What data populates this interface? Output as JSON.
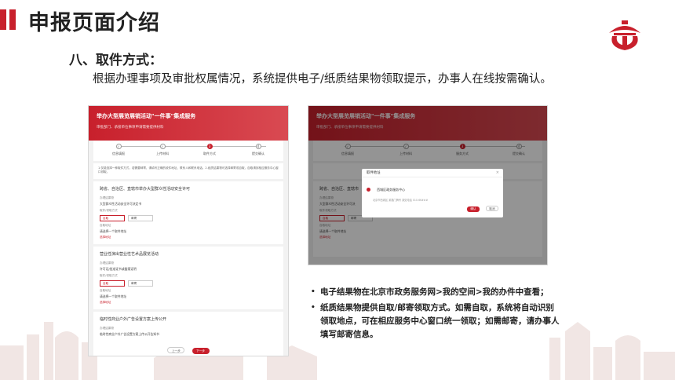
{
  "slide": {
    "title": "申报页面介绍",
    "section_title": "八、取件方式：",
    "section_desc": "根据办理事项及审批权属情况，系统提供电子/纸质结果物领取提示，办事人在线按需确认。"
  },
  "colors": {
    "accent": "#c8202c"
  },
  "logo_icon": "beijing-gov-logo-icon",
  "left_shot": {
    "banner_title": "举办大型展览展销活动\"一件事\"集成服务",
    "banner_sub": "审批部门、承接单位事项申请需要提供材料",
    "steps": [
      "信息填报",
      "上传材料",
      "取件方式",
      "提交确认"
    ],
    "active_step": 2,
    "notice": "1.仅能选择一种取件方式，若需要邮寄，请填写正确的收件地址、联系人和联系电话。2.纸质结果物可选择邮寄或自取，自取请到相应服务中心窗口领取。",
    "cards": [
      {
        "title": "跨省、自治区、直辖市举办大型群众性活动安全许可",
        "label1": "办理结果物",
        "value1": "大型群众性活动安全许可决定书",
        "label2": "取件/领取方式",
        "opt_a": "自取",
        "opt_b": "邮寄",
        "label3": "自取地址",
        "value3": "请选择一个取件地址",
        "link": "选择地址"
      },
      {
        "title": "营业性演出营业性艺术品展览活动",
        "label1": "办理结果物",
        "value1": "许可证/批准证书或备案证明",
        "label2": "取件/领取方式",
        "opt_a": "自取",
        "opt_b": "邮寄",
        "label3": "自取地址",
        "value3": "请选择一个取件地址",
        "link": "选择地址"
      },
      {
        "title": "临时性商业户外广告设置方案上传公开",
        "label1": "办理结果物",
        "value1": "临时性商业户外广告设置方案上传公开告知书"
      }
    ],
    "btn_prev": "上一步",
    "btn_next": "下一步"
  },
  "right_shot": {
    "banner_title": "举办大型展览展销活动\"一件事\"集成服务",
    "banner_sub": "审批部门、承接单位事项申请需要提供材料",
    "steps": [
      "信息填报",
      "上传材料",
      "服务方式",
      "提交确认"
    ],
    "card_title": "跨省、自治区、直辖市",
    "field1": "办理结果物",
    "value1": "大型群众性活动安全许可决",
    "field2": "取件领取方式",
    "opt_a": "自取",
    "opt_b": "邮寄",
    "field3": "自取地址",
    "value3": "请选择一个取件地址",
    "link": "选择地址",
    "dialog": {
      "title": "取件地址",
      "center": "西城区政务服务中心",
      "address": "北京市西城区 某路门牌号 某处电话 010-66###",
      "ok": "确认",
      "cancel": "取消"
    }
  },
  "bullets": [
    "电子结果物在北京市政务服务网>我的空间>我的办件中查看；",
    "纸质结果物提供自取/邮寄领取方式。如需自取，系统将自动识别领取地点，可在相应服务中心窗口统一领取；如需邮寄，请办事人填写邮寄信息。"
  ]
}
